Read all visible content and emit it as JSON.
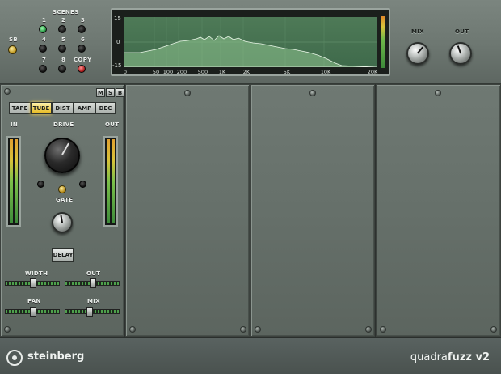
{
  "top": {
    "scenes_label": "SCENES",
    "sb_label": "SB",
    "scene_numbers": [
      "1",
      "2",
      "3",
      "4",
      "5",
      "6",
      "7",
      "8"
    ],
    "copy_label": "COPY",
    "mix_label": "MIX",
    "out_label": "OUT"
  },
  "spectrum": {
    "y_labels": [
      "15",
      "0",
      "-15"
    ],
    "x_labels": [
      "0",
      "50",
      "100",
      "200",
      "500",
      "1K",
      "2K",
      "5K",
      "10K",
      "20K"
    ]
  },
  "module": {
    "msb": [
      "M",
      "S",
      "B"
    ],
    "modes": [
      "TAPE",
      "TUBE",
      "DIST",
      "AMP",
      "DEC"
    ],
    "active_mode": "TUBE",
    "in_label": "IN",
    "out_label": "OUT",
    "drive_label": "DRIVE",
    "gate_label": "GATE",
    "delay_label": "DELAY",
    "width_label": "WIDTH",
    "delay_out_label": "OUT",
    "pan_label": "PAN",
    "mix_label": "MIX"
  },
  "footer": {
    "brand": "steinberg",
    "product_a": "quadra",
    "product_b": "fuzz",
    "product_c": " v2"
  },
  "colors": {
    "spectrum_fill": "#a8d8a8",
    "active_mode": "#e6b81a",
    "scene_active": "#1e8a3a",
    "copy_led": "#a51414"
  }
}
